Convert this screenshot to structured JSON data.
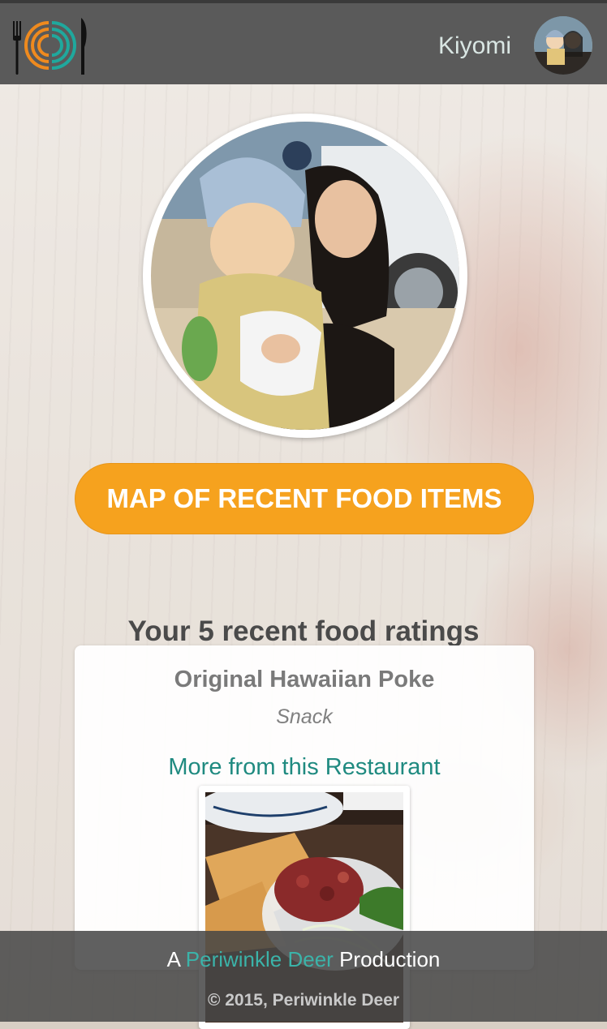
{
  "header": {
    "logo_icon": "fork-plate-knife-logo",
    "username": "Kiyomi",
    "avatar_icon": "user-avatar"
  },
  "profile": {
    "photo_icon": "profile-photo"
  },
  "map_button": {
    "label": "MAP OF RECENT FOOD ITEMS",
    "color": "#f6a21e"
  },
  "ratings": {
    "heading": "Your 5 recent food ratings",
    "items": [
      {
        "name": "Original Hawaiian Poke",
        "category": "Snack",
        "link_label": "More from this Restaurant",
        "photo_icon": "poke-bowl-photo"
      }
    ]
  },
  "footer": {
    "prefix": "A ",
    "brand": "Periwinkle Deer",
    "suffix": " Production",
    "copyright": "© 2015, Periwinkle Deer",
    "brand_color": "#3bb3a9"
  }
}
